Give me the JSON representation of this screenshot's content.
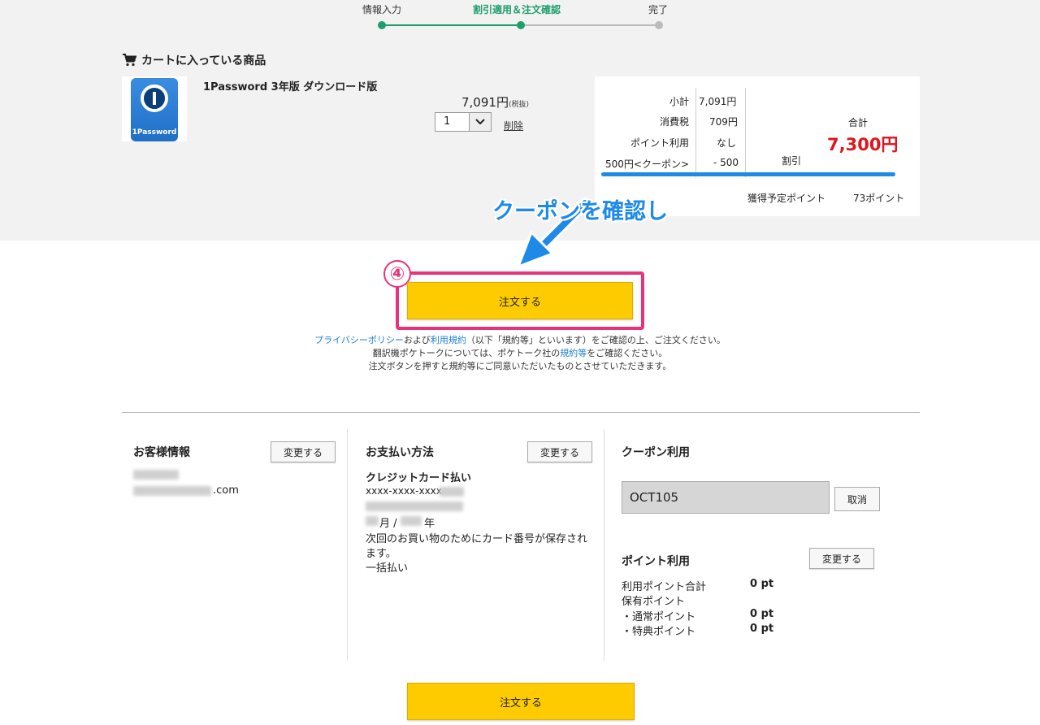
{
  "steps": [
    {
      "label": "情報入力",
      "state": "done"
    },
    {
      "label": "割引適用＆注文確認",
      "state": "current"
    },
    {
      "label": "完了",
      "state": "pending"
    }
  ],
  "colors": {
    "accent_green": "#1f9e6d",
    "price_red": "#e0141e",
    "order_yellow": "#fdcb00",
    "annotation_blue": "#1e8ae8",
    "annotation_pink": "#e8337a"
  },
  "cart": {
    "title": "カートに入っている商品",
    "icon": "cart-icon",
    "product": {
      "image_text": "1Password",
      "name": "1Password 3年版 ダウンロード版",
      "price": "7,091円",
      "tax_note": "(税抜)",
      "quantity": "1",
      "delete_label": "削除"
    }
  },
  "summary": {
    "subtotal_label": "小計",
    "subtotal_value": "7,091円",
    "tax_label": "消費税",
    "tax_value": "709円",
    "points_label": "ポイント利用",
    "points_value": "なし",
    "coupon_label": "500円<クーポン>",
    "coupon_value": "- 500",
    "discount_label": "割引",
    "total_label": "合計",
    "total_value": "7,300円",
    "earn_label": "獲得予定ポイント",
    "earn_value": "73ポイント"
  },
  "annotation": {
    "callout": "クーポンを確認し",
    "step_number": "④"
  },
  "order": {
    "button_label": "注文する"
  },
  "notice": {
    "line1_link1": "プライバシーポリシー",
    "line1_mid": "および",
    "line1_link2": "利用規約",
    "line1_rest": "（以下「規約等」といいます）をご確認の上、ご注文ください。",
    "line2_pre": "翻訳機ポケトークについては、ポケトーク社の",
    "line2_link": "規約等",
    "line2_post": "をご確認ください。",
    "line3": "注文ボタンを押すと規約等にご同意いただいたものとさせていただきます。"
  },
  "customer": {
    "title": "お客様情報",
    "change_label": "変更する",
    "email_suffix": ".com"
  },
  "payment": {
    "title": "お支払い方法",
    "change_label": "変更する",
    "method": "クレジットカード払い",
    "card_prefix": "xxxx-xxxx-xxxx-",
    "month_label": "月 /",
    "year_label": "年",
    "save_note_1": "次回のお買い物のためにカード番号が保存され",
    "save_note_2": "ます。",
    "installment": "一括払い"
  },
  "coupon": {
    "title": "クーポン利用",
    "code": "OCT105",
    "cancel_label": "取消"
  },
  "points": {
    "title": "ポイント利用",
    "change_label": "変更する",
    "total_label": "利用ポイント合計",
    "total_value": "0 pt",
    "held_label": "保有ポイント",
    "normal_label": "・通常ポイント",
    "normal_value": "0 pt",
    "bonus_label": "・特典ポイント",
    "bonus_value": "0 pt"
  }
}
